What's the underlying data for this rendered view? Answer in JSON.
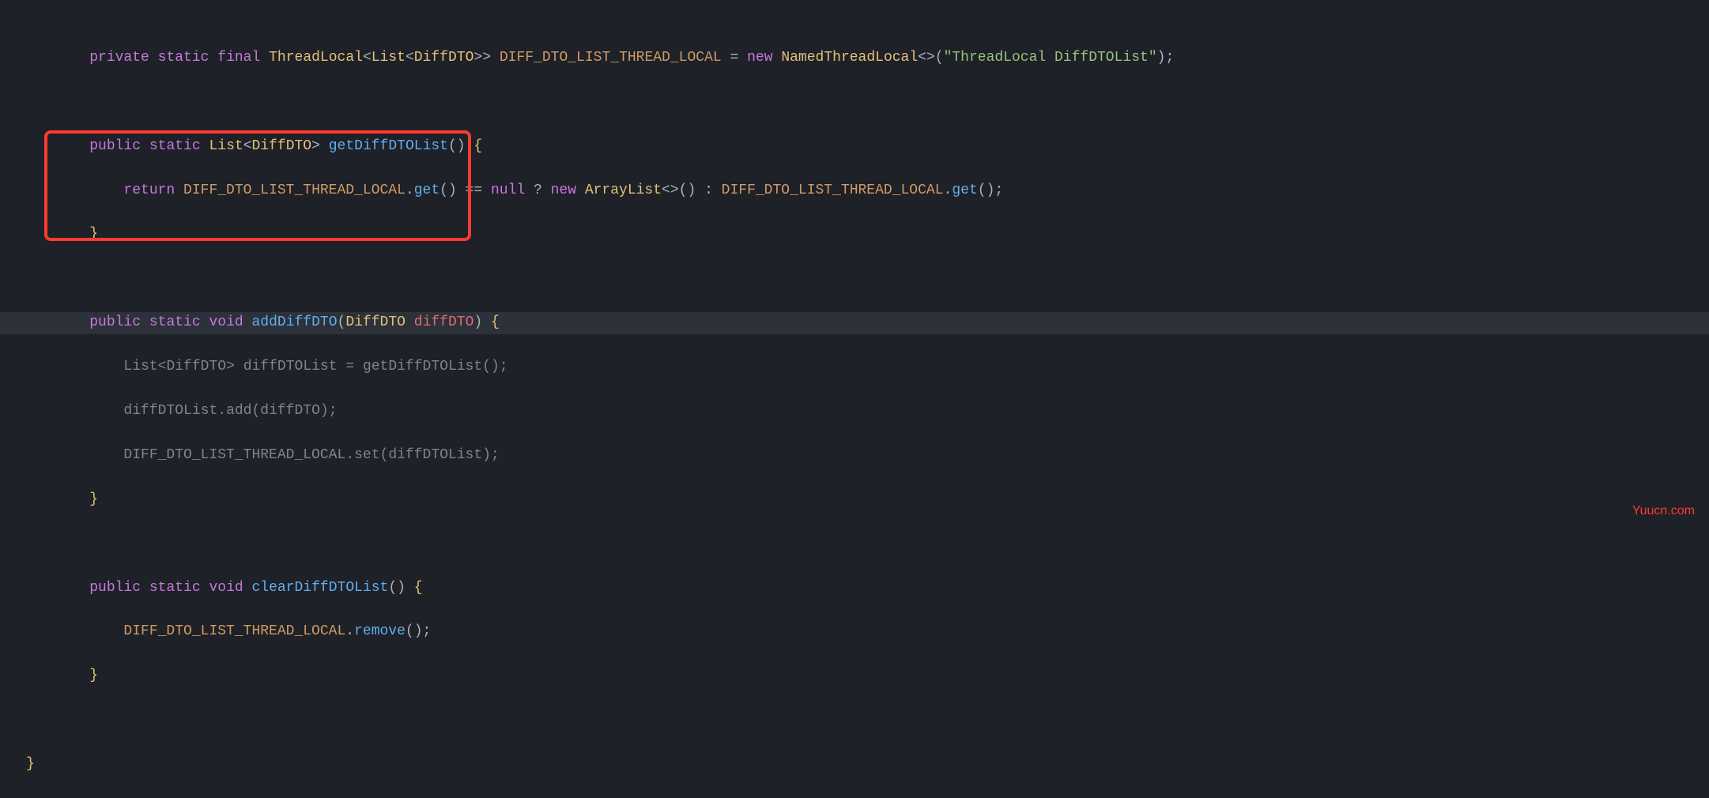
{
  "watermark": "Yuucn.com",
  "code": {
    "kw_private": "private",
    "kw_public": "public",
    "kw_static": "static",
    "kw_final": "final",
    "kw_void": "void",
    "kw_return": "return",
    "kw_new": "new",
    "kw_null": "null",
    "type_ThreadLocal": "ThreadLocal",
    "type_List": "List",
    "type_DiffDTO": "DiffDTO",
    "type_NamedThreadLocal": "NamedThreadLocal",
    "type_ArrayList": "ArrayList",
    "const_DIFF_DTO_LIST_THREAD_LOCAL": "DIFF_DTO_LIST_THREAD_LOCAL",
    "str_threadlocal": "\"ThreadLocal DiffDTOList\"",
    "method_getDiffDTOList": "getDiffDTOList",
    "method_addDiffDTO": "addDiffDTO",
    "method_clearDiffDTOList": "clearDiffDTOList",
    "method_get": "get",
    "method_set": "set",
    "method_add": "add",
    "method_remove": "remove",
    "ident_diffDTO": "diffDTO",
    "ident_diffDTOList": "diffDTOList",
    "punc_lt": "<",
    "punc_gt": ">",
    "punc_ltgt": "<>",
    "punc_lparen": "(",
    "punc_rparen": ")",
    "punc_lbrace": "{",
    "punc_rbrace": "}",
    "punc_semi": ";",
    "punc_dot": ".",
    "punc_eq": " = ",
    "punc_eqeq": " == ",
    "punc_q": " ? ",
    "punc_colon": " : ",
    "indent1": "    ",
    "indent2": "        ",
    "space": " "
  }
}
